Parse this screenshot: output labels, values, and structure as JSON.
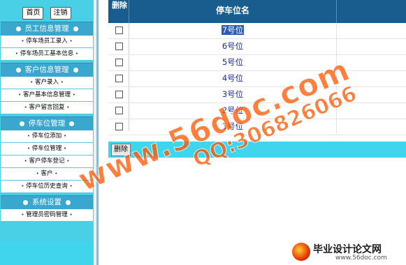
{
  "sidebar": {
    "top_buttons": [
      "首页",
      "注销"
    ],
    "sections": [
      {
        "title": "员工信息管理",
        "items": [
          "停车场员工录入",
          "停车场员工基本信息"
        ]
      },
      {
        "title": "客户信息管理",
        "items": [
          "客户录入",
          "客户基本信息管理",
          "客户留言回复"
        ]
      },
      {
        "title": "停车位管理",
        "items": [
          "停车位添加",
          "停车位管理",
          "客户停车登记",
          "客户",
          "停车位历史查询"
        ]
      },
      {
        "title": "系统设置",
        "items": [
          "管理员密码管理"
        ]
      }
    ]
  },
  "table": {
    "col_delete": "删除",
    "col_name": "停车位名",
    "rows": [
      "7号位",
      "6号位",
      "5号位",
      "4号位",
      "3号位",
      "2号位",
      "1号位"
    ],
    "selected_index": 0
  },
  "action_bar": {
    "delete_button": "删除"
  },
  "watermark": {
    "site": "www.56doc.com",
    "qq": "QQ:306826066",
    "logo_title": "毕业设计论文网",
    "logo_url": "www.56doc.com"
  },
  "colors": {
    "sidebar_bg": "#49cfe6",
    "section_bg": "#3aa7cf",
    "header_bg": "#195d8e",
    "watermark": "#ff5500"
  }
}
